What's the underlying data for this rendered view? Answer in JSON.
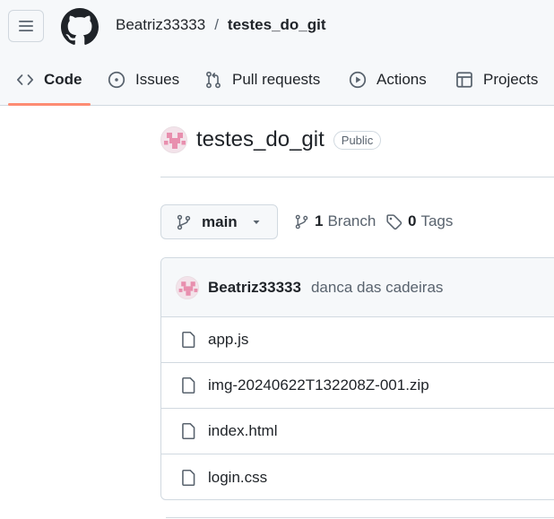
{
  "header": {
    "menu_icon": "hamburger-icon",
    "logo_icon": "github-logo-icon",
    "owner": "Beatriz33333",
    "separator": "/",
    "repo": "testes_do_git"
  },
  "tabs": [
    {
      "label": "Code",
      "icon": "code-icon",
      "selected": true
    },
    {
      "label": "Issues",
      "icon": "issue-opened-icon",
      "selected": false
    },
    {
      "label": "Pull requests",
      "icon": "git-pull-request-icon",
      "selected": false
    },
    {
      "label": "Actions",
      "icon": "play-icon",
      "selected": false
    },
    {
      "label": "Projects",
      "icon": "table-icon",
      "selected": false
    }
  ],
  "repo": {
    "name": "testes_do_git",
    "visibility": "Public"
  },
  "branch": {
    "current": "main",
    "branch_count": "1",
    "branch_label": "Branch",
    "tag_count": "0",
    "tag_label": "Tags"
  },
  "commit": {
    "author": "Beatriz33333",
    "message": "danca das cadeiras"
  },
  "files": [
    {
      "name": "app.js",
      "icon": "file-icon"
    },
    {
      "name": "img-20240622T132208Z-001.zip",
      "icon": "file-icon"
    },
    {
      "name": "index.html",
      "icon": "file-icon"
    },
    {
      "name": "login.css",
      "icon": "file-icon"
    }
  ],
  "colors": {
    "accent_underline": "#fd8c73",
    "header_bg": "#f6f8fa",
    "border": "#d1d9e0",
    "muted_text": "#59636e"
  }
}
